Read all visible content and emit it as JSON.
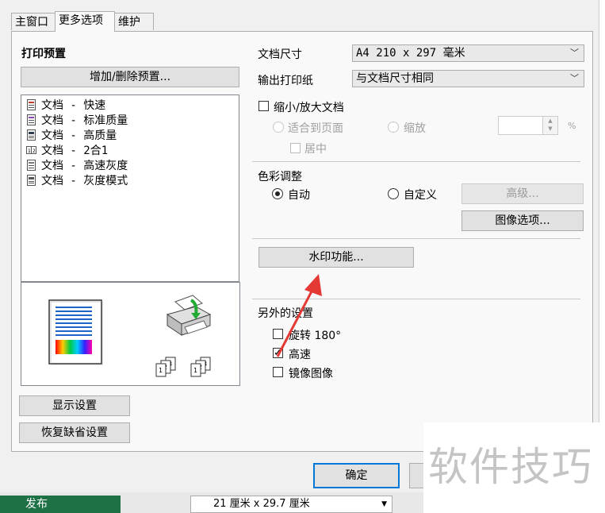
{
  "tabs": [
    "主窗口",
    "更多选项",
    "维护"
  ],
  "presets": {
    "title": "打印预置",
    "add_remove_button": "增加/删除预置...",
    "items": [
      "文档 - 快速",
      "文档 - 标准质量",
      "文档 - 高质量",
      "文档 - 2合1",
      "文档 - 高速灰度",
      "文档 - 灰度模式"
    ]
  },
  "paper": {
    "doc_size_label": "文档尺寸",
    "doc_size_value": "A4 210 x 297 毫米",
    "output_paper_label": "输出打印纸",
    "output_paper_value": "与文档尺寸相同"
  },
  "scaling": {
    "reduce_enlarge_label": "缩小/放大文档",
    "fit_to_page_label": "适合到页面",
    "zoom_label": "缩放",
    "percent_symbol": "%",
    "center_label": "居中"
  },
  "color": {
    "title": "色彩调整",
    "auto_label": "自动",
    "custom_label": "自定义",
    "advanced_button": "高级...",
    "image_options_button": "图像选项..."
  },
  "watermark_button": "水印功能...",
  "other": {
    "title": "另外的设置",
    "rotate_label": "旋转 180°",
    "high_speed_label": "高速",
    "mirror_label": "镜像图像",
    "high_speed_checked": true
  },
  "footer": {
    "show_settings_button": "显示设置",
    "restore_defaults_button": "恢复缺省设置",
    "ok_button": "确定"
  },
  "background": {
    "taskbar_text": "发布",
    "page_size_text": "21 厘米 x 29.7 厘米"
  },
  "watermark_text": "软件技巧",
  "colors": {
    "accent": "#0078d7",
    "arrow": "#e53935",
    "taskbar": "#1e7145"
  }
}
